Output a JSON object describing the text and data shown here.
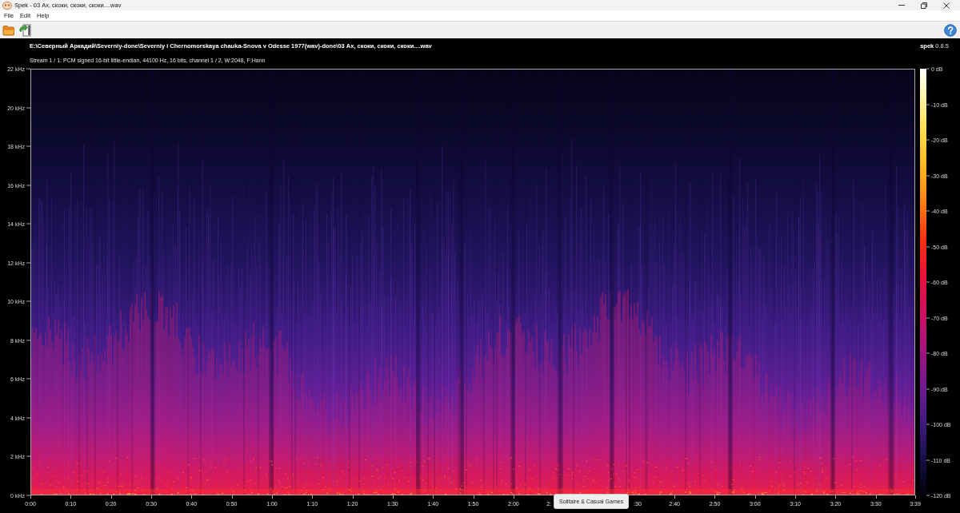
{
  "window": {
    "title": "Spek - 03 Ах, скоки, скоки, скоки....wav"
  },
  "menu": [
    "File",
    "Edit",
    "Help"
  ],
  "header": {
    "file_path": "E:\\Северный Аркадий\\Severniy-done\\Severniy i Chernomorskaya chauka-Snova v Odesse 1977(wav)-done\\03 Ах, скоки, скоки, скоки....wav",
    "version": "**spek** 0.8.5",
    "stream_info": "Stream 1 / 1: PCM signed 16-bit little-endian, 44100 Hz, 16 bits, channel 1 / 2, W:2048, F:Hann"
  },
  "frequency_axis": [
    "22 kHz",
    "20 kHz",
    "18 kHz",
    "16 kHz",
    "14 kHz",
    "12 kHz",
    "10 kHz",
    "8 kHz",
    "6 kHz",
    "4 kHz",
    "2 kHz",
    "0 kHz"
  ],
  "time_axis": [
    {
      "label": "0:00",
      "kind": "whole"
    },
    {
      "label": "0:10",
      "kind": "whole"
    },
    {
      "label": "0:20",
      "kind": "whole"
    },
    {
      "label": "0:30",
      "kind": "whole"
    },
    {
      "label": "0:40",
      "kind": "whole"
    },
    {
      "label": "0:50",
      "kind": "whole"
    },
    {
      "label": "1:00",
      "kind": "whole"
    },
    {
      "label": "1:10",
      "kind": "whole"
    },
    {
      "label": "1:20",
      "kind": "whole"
    },
    {
      "label": "1:30",
      "kind": "whole"
    },
    {
      "label": "1:40",
      "kind": "whole"
    },
    {
      "label": "1:50",
      "kind": "whole"
    },
    {
      "label": "2:00",
      "kind": "whole"
    },
    {
      "label": "2:",
      "kind": "cut-end"
    },
    {
      "kind": "covered"
    },
    {
      "label": ":30",
      "kind": "cut-start"
    },
    {
      "label": "2:40",
      "kind": "whole"
    },
    {
      "label": "2:50",
      "kind": "whole"
    },
    {
      "label": "3:00",
      "kind": "whole"
    },
    {
      "label": "3:10",
      "kind": "whole"
    },
    {
      "label": "3:20",
      "kind": "whole"
    },
    {
      "label": "3:30",
      "kind": "whole"
    },
    {
      "label": "3:39",
      "kind": "whole"
    }
  ],
  "db_scale": [
    "0 dB",
    "-10 dB",
    "-20 dB",
    "-30 dB",
    "-40 dB",
    "-50 dB",
    "-60 dB",
    "-70 dB",
    "-80 dB",
    "-90 dB",
    "-100 dB",
    "-110 dB",
    "-120 dB"
  ],
  "tooltip": {
    "text": "Solitaire & Casual Games"
  }
}
